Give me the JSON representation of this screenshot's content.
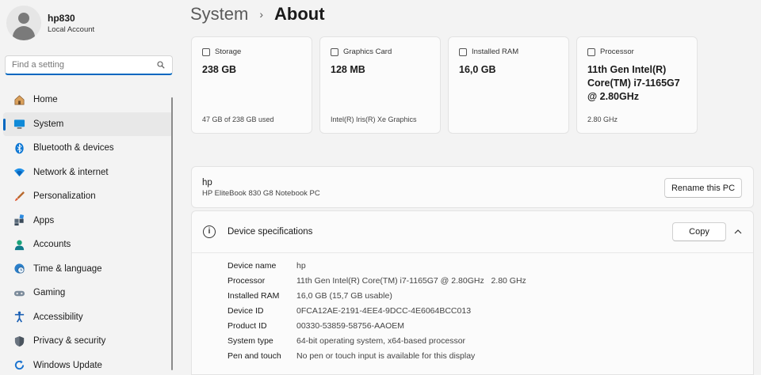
{
  "user": {
    "name": "hp830",
    "account_type": "Local Account"
  },
  "search": {
    "placeholder": "Find a setting"
  },
  "nav": {
    "items": [
      {
        "label": "Home",
        "icon": "home-icon"
      },
      {
        "label": "System",
        "icon": "system-icon"
      },
      {
        "label": "Bluetooth & devices",
        "icon": "bluetooth-icon"
      },
      {
        "label": "Network & internet",
        "icon": "wifi-icon"
      },
      {
        "label": "Personalization",
        "icon": "brush-icon"
      },
      {
        "label": "Apps",
        "icon": "apps-icon"
      },
      {
        "label": "Accounts",
        "icon": "accounts-icon"
      },
      {
        "label": "Time & language",
        "icon": "globe-clock-icon"
      },
      {
        "label": "Gaming",
        "icon": "gamepad-icon"
      },
      {
        "label": "Accessibility",
        "icon": "accessibility-icon"
      },
      {
        "label": "Privacy & security",
        "icon": "shield-icon"
      },
      {
        "label": "Windows Update",
        "icon": "update-icon"
      }
    ],
    "active": "System"
  },
  "breadcrumb": {
    "parent": "System",
    "separator": "›",
    "current": "About"
  },
  "cards": [
    {
      "title": "Storage",
      "value": "238 GB",
      "detail": "47 GB of 238 GB used",
      "icon": "storage-icon"
    },
    {
      "title": "Graphics Card",
      "value": "128 MB",
      "detail": "Intel(R) Iris(R) Xe Graphics",
      "icon": "graphics-card-icon"
    },
    {
      "title": "Installed RAM",
      "value": "16,0 GB",
      "detail": "",
      "icon": "ram-icon"
    },
    {
      "title": "Processor",
      "value": "11th Gen Intel(R) Core(TM) i7-1165G7 @ 2.80GHz",
      "detail": "2.80 GHz",
      "icon": "processor-icon"
    }
  ],
  "device": {
    "name": "hp",
    "model": "HP EliteBook 830 G8 Notebook PC",
    "rename_label": "Rename this PC"
  },
  "specs": {
    "title": "Device specifications",
    "copy_label": "Copy",
    "rows": [
      {
        "label": "Device name",
        "value": "hp"
      },
      {
        "label": "Processor",
        "value": "11th Gen Intel(R) Core(TM) i7-1165G7 @ 2.80GHz   2.80 GHz"
      },
      {
        "label": "Installed RAM",
        "value": "16,0 GB (15,7 GB usable)"
      },
      {
        "label": "Device ID",
        "value": "0FCA12AE-2191-4EE4-9DCC-4E6064BCC013"
      },
      {
        "label": "Product ID",
        "value": "00330-53859-58756-AAOEM"
      },
      {
        "label": "System type",
        "value": "64-bit operating system, x64-based processor"
      },
      {
        "label": "Pen and touch",
        "value": "No pen or touch input is available for this display"
      }
    ]
  },
  "colors": {
    "accent": "#0067c0",
    "background": "#f3f3f3",
    "card": "#fbfbfb"
  }
}
